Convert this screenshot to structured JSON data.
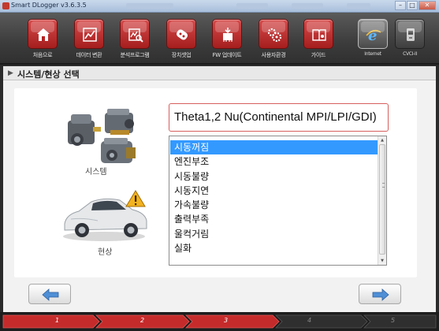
{
  "window": {
    "title": "Smart DLogger v3.6.3.5",
    "controls": [
      "minimize",
      "maximize",
      "close"
    ]
  },
  "toolbar": {
    "buttons": [
      {
        "label": "처음으로",
        "icon": "home-icon"
      },
      {
        "label": "데이터 변환",
        "icon": "data-convert-icon"
      },
      {
        "label": "분석프로그램",
        "icon": "analysis-icon"
      },
      {
        "label": "장치셋업",
        "icon": "device-setup-icon"
      },
      {
        "label": "FW 업데이트",
        "icon": "fw-update-icon"
      },
      {
        "label": "사용자환경",
        "icon": "user-settings-icon"
      },
      {
        "label": "가이드",
        "icon": "guide-icon"
      }
    ],
    "connection": [
      {
        "label": "Internet",
        "icon": "internet-icon"
      },
      {
        "label": "CVCI-II",
        "icon": "cvci-device-icon"
      }
    ]
  },
  "breadcrumb": {
    "title": "시스템/현상 선택"
  },
  "main": {
    "system_label": "시스템",
    "symptom_label": "현상",
    "selected_engine": "Theta1,2 Nu(Continental MPI/LPI/GDI)",
    "symptoms": [
      "시동꺼짐",
      "엔진부조",
      "시동불량",
      "시동지연",
      "가속불량",
      "출력부족",
      "울컥거림",
      "실화"
    ],
    "selected_index": 0
  },
  "steps": [
    "1",
    "2",
    "3",
    "4",
    "5"
  ],
  "active_steps": 3,
  "colors": {
    "accent_red": "#c52b2b",
    "selection_blue": "#3399ff",
    "engine_box_border": "#d75e5e"
  }
}
